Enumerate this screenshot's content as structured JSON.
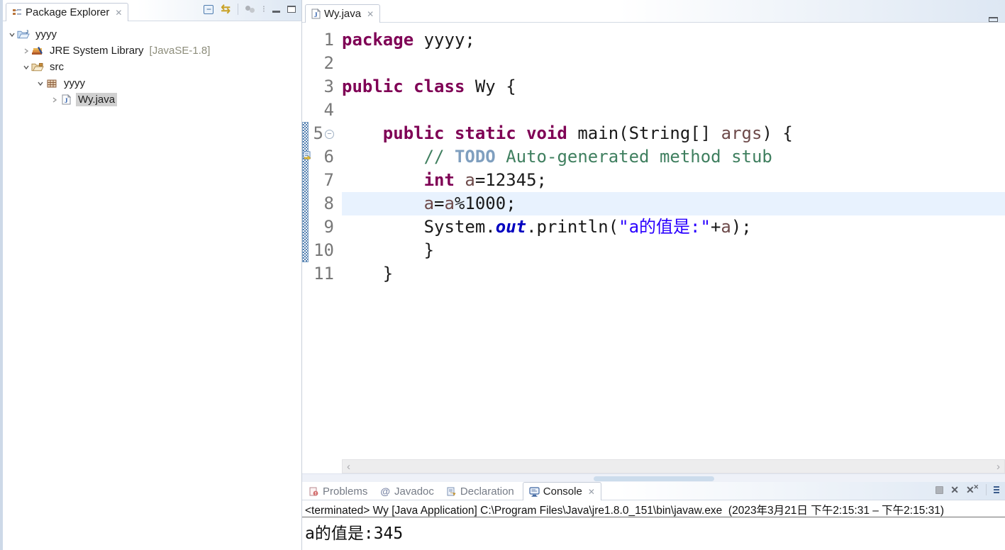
{
  "colors": {
    "kw": "#7f0055",
    "plain": "#1a1a1a",
    "comment": "#3f7f5f",
    "todo": "#7f9fbf",
    "string": "#2a00ff",
    "field": "#0000c0",
    "variable": "#6d4a4a",
    "line-number": "#787878",
    "current-line-bg": "#e8f2fe",
    "range-bar": "#4f7cae",
    "decoration": "#8c8c7a",
    "selection-bg": "#d0d0d0",
    "accent-gold": "#c9a227"
  },
  "package_explorer": {
    "tab_label": "Package Explorer",
    "toolbar_icons": [
      "collapse-all-icon",
      "link-with-editor-icon",
      "focus-dots-icon",
      "view-menu-icon",
      "minimize-icon",
      "maximize-icon"
    ],
    "tree": {
      "project": "yyyy",
      "jre_library": "JRE System Library",
      "jre_decoration": "[JavaSE-1.8]",
      "source_folder": "src",
      "package": "yyyy",
      "file": "Wy.java"
    }
  },
  "editor": {
    "tab_label": "Wy.java",
    "fold_glyph": "−",
    "scroll_left": "‹",
    "scroll_right": "›",
    "lines": [
      {
        "num": "1",
        "segments": [
          "package",
          " yyyy;"
        ]
      },
      {
        "num": "2",
        "segments": []
      },
      {
        "num": "3",
        "segments": [
          "public class",
          " Wy {"
        ]
      },
      {
        "num": "4",
        "segments": []
      },
      {
        "num": "5",
        "segments": [
          "\t",
          "public static void",
          " main(String[] ",
          "args",
          ") {"
        ]
      },
      {
        "num": "6",
        "segments": [
          "\t\t",
          "// ",
          "TODO",
          " Auto-generated method stub"
        ]
      },
      {
        "num": "7",
        "segments": [
          "\t\t",
          "int",
          " ",
          "a",
          "=12345;"
        ]
      },
      {
        "num": "8",
        "segments": [
          "\t\t",
          "a",
          "=",
          "a",
          "%1000;"
        ]
      },
      {
        "num": "9",
        "segments": [
          "\t\t",
          "System.",
          "out",
          ".println(",
          "\"a的值是:\"",
          "+",
          "a",
          ");"
        ]
      },
      {
        "num": "10",
        "segments": [
          "\t\t}"
        ]
      },
      {
        "num": "11",
        "segments": [
          "\t}"
        ]
      }
    ]
  },
  "console": {
    "tabs": [
      {
        "label": "Problems"
      },
      {
        "label": "Javadoc"
      },
      {
        "label": "Declaration"
      },
      {
        "label": "Console"
      }
    ],
    "javadoc_glyph": "@",
    "status_line": "<terminated> Wy [Java Application] C:\\Program Files\\Java\\jre1.8.0_151\\bin\\javaw.exe  (2023年3月21日 下午2:15:31 – 下午2:15:31)",
    "output": "a的值是:345"
  }
}
